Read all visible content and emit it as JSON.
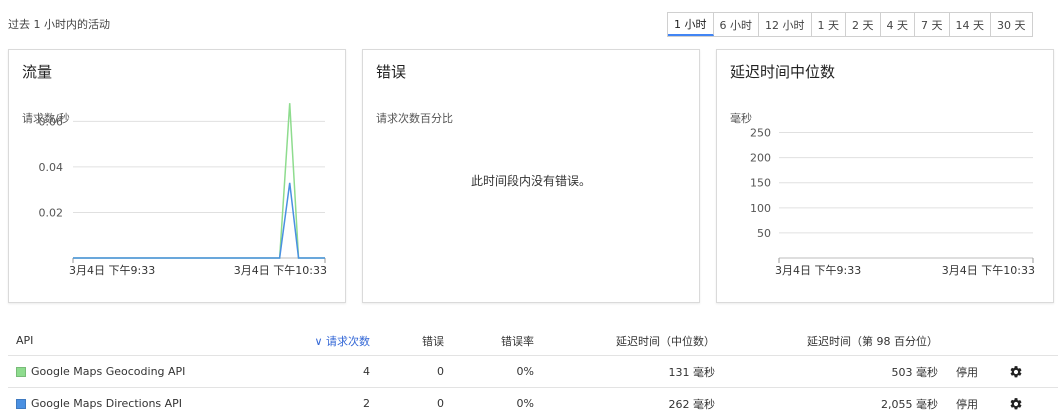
{
  "header": {
    "period_label": "过去 1 小时内的活动"
  },
  "ranges": [
    {
      "label": "1 小时",
      "active": true
    },
    {
      "label": "6 小时",
      "active": false
    },
    {
      "label": "12 小时",
      "active": false
    },
    {
      "label": "1 天",
      "active": false
    },
    {
      "label": "2 天",
      "active": false
    },
    {
      "label": "4 天",
      "active": false
    },
    {
      "label": "7 天",
      "active": false
    },
    {
      "label": "14 天",
      "active": false
    },
    {
      "label": "30 天",
      "active": false
    }
  ],
  "cards": {
    "traffic": {
      "title": "流量",
      "subtitle": "请求数/秒"
    },
    "errors": {
      "title": "错误",
      "subtitle": "请求次数百分比",
      "empty": "此时间段内没有错误。"
    },
    "latency": {
      "title": "延迟时间中位数",
      "subtitle": "毫秒"
    }
  },
  "chart_data": [
    {
      "type": "line",
      "x": [
        "3月4日 下午9:33",
        "3月4日 下午10:33"
      ],
      "ylim": [
        0,
        0.065
      ],
      "y_ticks": [
        "0.02",
        "0.04",
        "0.06"
      ],
      "series": [
        {
          "color": "#8edc8e",
          "points": [
            [
              0,
              0
            ],
            [
              0.82,
              0
            ],
            [
              0.86,
              0.068
            ],
            [
              0.895,
              0
            ],
            [
              1,
              0
            ]
          ]
        },
        {
          "color": "#4a90e2",
          "points": [
            [
              0,
              0
            ],
            [
              0.82,
              0
            ],
            [
              0.86,
              0.033
            ],
            [
              0.895,
              0
            ],
            [
              1,
              0
            ]
          ]
        }
      ]
    },
    {
      "type": "line",
      "x": [
        "3月4日 下午9:33",
        "3月4日 下午10:33"
      ],
      "ylim": [
        0,
        275
      ],
      "y_ticks": [
        "50",
        "100",
        "150",
        "200",
        "250"
      ],
      "series": []
    }
  ],
  "table": {
    "columns": {
      "api": "API",
      "requests": "请求次数",
      "errors": "错误",
      "error_rate": "错误率",
      "latency": "延迟时间（中位数）",
      "latency98": "延迟时间（第 98 百分位）"
    },
    "sort_indicator": "∨",
    "rows": [
      {
        "color": "#8edc8e",
        "name": "Google Maps Geocoding API",
        "requests": "4",
        "errors": "0",
        "error_rate": "0%",
        "latency": "131 毫秒",
        "latency98": "503 毫秒",
        "action": "停用"
      },
      {
        "color": "#4a90e2",
        "name": "Google Maps Directions API",
        "requests": "2",
        "errors": "0",
        "error_rate": "0%",
        "latency": "262 毫秒",
        "latency98": "2,055 毫秒",
        "action": "停用"
      }
    ]
  }
}
